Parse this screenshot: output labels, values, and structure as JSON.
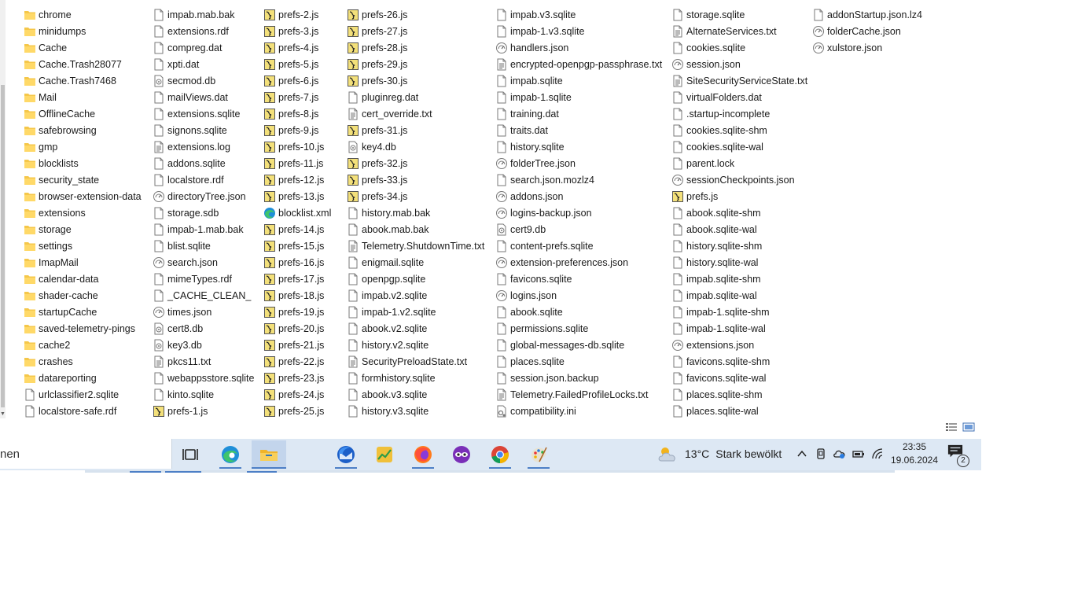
{
  "explorer": {
    "columns": [
      [
        {
          "name": "chrome",
          "icon": "folder-icon"
        },
        {
          "name": "minidumps",
          "icon": "folder-icon"
        },
        {
          "name": "Cache",
          "icon": "folder-icon"
        },
        {
          "name": "Cache.Trash28077",
          "icon": "folder-icon"
        },
        {
          "name": "Cache.Trash7468",
          "icon": "folder-icon"
        },
        {
          "name": "Mail",
          "icon": "folder-icon"
        },
        {
          "name": "OfflineCache",
          "icon": "folder-icon"
        },
        {
          "name": "safebrowsing",
          "icon": "folder-icon"
        },
        {
          "name": "gmp",
          "icon": "folder-icon"
        },
        {
          "name": "blocklists",
          "icon": "folder-icon"
        },
        {
          "name": "security_state",
          "icon": "folder-icon"
        },
        {
          "name": "browser-extension-data",
          "icon": "folder-icon"
        },
        {
          "name": "extensions",
          "icon": "folder-icon"
        },
        {
          "name": "storage",
          "icon": "folder-icon"
        },
        {
          "name": "settings",
          "icon": "folder-icon"
        },
        {
          "name": "ImapMail",
          "icon": "folder-icon"
        },
        {
          "name": "calendar-data",
          "icon": "folder-icon"
        },
        {
          "name": "shader-cache",
          "icon": "folder-icon"
        },
        {
          "name": "startupCache",
          "icon": "folder-icon"
        },
        {
          "name": "saved-telemetry-pings",
          "icon": "folder-icon"
        },
        {
          "name": "cache2",
          "icon": "folder-icon"
        },
        {
          "name": "crashes",
          "icon": "folder-icon"
        },
        {
          "name": "datareporting",
          "icon": "folder-icon"
        },
        {
          "name": "urlclassifier2.sqlite",
          "icon": "file-icon"
        },
        {
          "name": "localstore-safe.rdf",
          "icon": "file-icon"
        }
      ],
      [
        {
          "name": "impab.mab.bak",
          "icon": "file-icon"
        },
        {
          "name": "extensions.rdf",
          "icon": "file-icon"
        },
        {
          "name": "compreg.dat",
          "icon": "file-icon"
        },
        {
          "name": "xpti.dat",
          "icon": "file-icon"
        },
        {
          "name": "secmod.db",
          "icon": "db-file-icon"
        },
        {
          "name": "mailViews.dat",
          "icon": "file-icon"
        },
        {
          "name": "extensions.sqlite",
          "icon": "file-icon"
        },
        {
          "name": "signons.sqlite",
          "icon": "file-icon"
        },
        {
          "name": "extensions.log",
          "icon": "text-file-icon"
        },
        {
          "name": "addons.sqlite",
          "icon": "file-icon"
        },
        {
          "name": "localstore.rdf",
          "icon": "file-icon"
        },
        {
          "name": "directoryTree.json",
          "icon": "json-file-icon"
        },
        {
          "name": "storage.sdb",
          "icon": "file-icon"
        },
        {
          "name": "impab-1.mab.bak",
          "icon": "file-icon"
        },
        {
          "name": "blist.sqlite",
          "icon": "file-icon"
        },
        {
          "name": "search.json",
          "icon": "json-file-icon"
        },
        {
          "name": "mimeTypes.rdf",
          "icon": "file-icon"
        },
        {
          "name": "_CACHE_CLEAN_",
          "icon": "file-icon"
        },
        {
          "name": "times.json",
          "icon": "json-file-icon"
        },
        {
          "name": "cert8.db",
          "icon": "db-file-icon"
        },
        {
          "name": "key3.db",
          "icon": "db-file-icon"
        },
        {
          "name": "pkcs11.txt",
          "icon": "text-file-icon"
        },
        {
          "name": "webappsstore.sqlite",
          "icon": "file-icon"
        },
        {
          "name": "kinto.sqlite",
          "icon": "file-icon"
        },
        {
          "name": "prefs-1.js",
          "icon": "js-file-icon"
        }
      ],
      [
        {
          "name": "prefs-2.js",
          "icon": "js-file-icon"
        },
        {
          "name": "prefs-3.js",
          "icon": "js-file-icon"
        },
        {
          "name": "prefs-4.js",
          "icon": "js-file-icon"
        },
        {
          "name": "prefs-5.js",
          "icon": "js-file-icon"
        },
        {
          "name": "prefs-6.js",
          "icon": "js-file-icon"
        },
        {
          "name": "prefs-7.js",
          "icon": "js-file-icon"
        },
        {
          "name": "prefs-8.js",
          "icon": "js-file-icon"
        },
        {
          "name": "prefs-9.js",
          "icon": "js-file-icon"
        },
        {
          "name": "prefs-10.js",
          "icon": "js-file-icon"
        },
        {
          "name": "prefs-11.js",
          "icon": "js-file-icon"
        },
        {
          "name": "prefs-12.js",
          "icon": "js-file-icon"
        },
        {
          "name": "prefs-13.js",
          "icon": "js-file-icon"
        },
        {
          "name": "blocklist.xml",
          "icon": "edge-file-icon"
        },
        {
          "name": "prefs-14.js",
          "icon": "js-file-icon"
        },
        {
          "name": "prefs-15.js",
          "icon": "js-file-icon"
        },
        {
          "name": "prefs-16.js",
          "icon": "js-file-icon"
        },
        {
          "name": "prefs-17.js",
          "icon": "js-file-icon"
        },
        {
          "name": "prefs-18.js",
          "icon": "js-file-icon"
        },
        {
          "name": "prefs-19.js",
          "icon": "js-file-icon"
        },
        {
          "name": "prefs-20.js",
          "icon": "js-file-icon"
        },
        {
          "name": "prefs-21.js",
          "icon": "js-file-icon"
        },
        {
          "name": "prefs-22.js",
          "icon": "js-file-icon"
        },
        {
          "name": "prefs-23.js",
          "icon": "js-file-icon"
        },
        {
          "name": "prefs-24.js",
          "icon": "js-file-icon"
        },
        {
          "name": "prefs-25.js",
          "icon": "js-file-icon"
        }
      ],
      [
        {
          "name": "prefs-26.js",
          "icon": "js-file-icon"
        },
        {
          "name": "prefs-27.js",
          "icon": "js-file-icon"
        },
        {
          "name": "prefs-28.js",
          "icon": "js-file-icon"
        },
        {
          "name": "prefs-29.js",
          "icon": "js-file-icon"
        },
        {
          "name": "prefs-30.js",
          "icon": "js-file-icon"
        },
        {
          "name": "pluginreg.dat",
          "icon": "file-icon"
        },
        {
          "name": "cert_override.txt",
          "icon": "text-file-icon"
        },
        {
          "name": "prefs-31.js",
          "icon": "js-file-icon"
        },
        {
          "name": "key4.db",
          "icon": "db-file-icon"
        },
        {
          "name": "prefs-32.js",
          "icon": "js-file-icon"
        },
        {
          "name": "prefs-33.js",
          "icon": "js-file-icon"
        },
        {
          "name": "prefs-34.js",
          "icon": "js-file-icon"
        },
        {
          "name": "history.mab.bak",
          "icon": "file-icon"
        },
        {
          "name": "abook.mab.bak",
          "icon": "file-icon"
        },
        {
          "name": "Telemetry.ShutdownTime.txt",
          "icon": "text-file-icon"
        },
        {
          "name": "enigmail.sqlite",
          "icon": "file-icon"
        },
        {
          "name": "openpgp.sqlite",
          "icon": "file-icon"
        },
        {
          "name": "impab.v2.sqlite",
          "icon": "file-icon"
        },
        {
          "name": "impab-1.v2.sqlite",
          "icon": "file-icon"
        },
        {
          "name": "abook.v2.sqlite",
          "icon": "file-icon"
        },
        {
          "name": "history.v2.sqlite",
          "icon": "file-icon"
        },
        {
          "name": "SecurityPreloadState.txt",
          "icon": "text-file-icon"
        },
        {
          "name": "formhistory.sqlite",
          "icon": "file-icon"
        },
        {
          "name": "abook.v3.sqlite",
          "icon": "file-icon"
        },
        {
          "name": "history.v3.sqlite",
          "icon": "file-icon"
        }
      ],
      [
        {
          "name": "impab.v3.sqlite",
          "icon": "file-icon"
        },
        {
          "name": "impab-1.v3.sqlite",
          "icon": "file-icon"
        },
        {
          "name": "handlers.json",
          "icon": "json-file-icon"
        },
        {
          "name": "encrypted-openpgp-passphrase.txt",
          "icon": "text-file-icon"
        },
        {
          "name": "impab.sqlite",
          "icon": "file-icon"
        },
        {
          "name": "impab-1.sqlite",
          "icon": "file-icon"
        },
        {
          "name": "training.dat",
          "icon": "file-icon"
        },
        {
          "name": "traits.dat",
          "icon": "file-icon"
        },
        {
          "name": "history.sqlite",
          "icon": "file-icon"
        },
        {
          "name": "folderTree.json",
          "icon": "json-file-icon"
        },
        {
          "name": "search.json.mozlz4",
          "icon": "file-icon"
        },
        {
          "name": "addons.json",
          "icon": "json-file-icon"
        },
        {
          "name": "logins-backup.json",
          "icon": "json-file-icon"
        },
        {
          "name": "cert9.db",
          "icon": "db-file-icon"
        },
        {
          "name": "content-prefs.sqlite",
          "icon": "file-icon"
        },
        {
          "name": "extension-preferences.json",
          "icon": "json-file-icon"
        },
        {
          "name": "favicons.sqlite",
          "icon": "file-icon"
        },
        {
          "name": "logins.json",
          "icon": "json-file-icon"
        },
        {
          "name": "abook.sqlite",
          "icon": "file-icon"
        },
        {
          "name": "permissions.sqlite",
          "icon": "file-icon"
        },
        {
          "name": "global-messages-db.sqlite",
          "icon": "file-icon"
        },
        {
          "name": "places.sqlite",
          "icon": "file-icon"
        },
        {
          "name": "session.json.backup",
          "icon": "file-icon"
        },
        {
          "name": "Telemetry.FailedProfileLocks.txt",
          "icon": "text-file-icon"
        },
        {
          "name": "compatibility.ini",
          "icon": "ini-file-icon"
        }
      ],
      [
        {
          "name": "storage.sqlite",
          "icon": "file-icon"
        },
        {
          "name": "AlternateServices.txt",
          "icon": "text-file-icon"
        },
        {
          "name": "cookies.sqlite",
          "icon": "file-icon"
        },
        {
          "name": "session.json",
          "icon": "json-file-icon"
        },
        {
          "name": "SiteSecurityServiceState.txt",
          "icon": "text-file-icon"
        },
        {
          "name": "virtualFolders.dat",
          "icon": "file-icon"
        },
        {
          "name": ".startup-incomplete",
          "icon": "file-icon"
        },
        {
          "name": "cookies.sqlite-shm",
          "icon": "file-icon"
        },
        {
          "name": "cookies.sqlite-wal",
          "icon": "file-icon"
        },
        {
          "name": "parent.lock",
          "icon": "file-icon"
        },
        {
          "name": "sessionCheckpoints.json",
          "icon": "json-file-icon"
        },
        {
          "name": "prefs.js",
          "icon": "js-file-icon"
        },
        {
          "name": "abook.sqlite-shm",
          "icon": "file-icon"
        },
        {
          "name": "abook.sqlite-wal",
          "icon": "file-icon"
        },
        {
          "name": "history.sqlite-shm",
          "icon": "file-icon"
        },
        {
          "name": "history.sqlite-wal",
          "icon": "file-icon"
        },
        {
          "name": "impab.sqlite-shm",
          "icon": "file-icon"
        },
        {
          "name": "impab.sqlite-wal",
          "icon": "file-icon"
        },
        {
          "name": "impab-1.sqlite-shm",
          "icon": "file-icon"
        },
        {
          "name": "impab-1.sqlite-wal",
          "icon": "file-icon"
        },
        {
          "name": "extensions.json",
          "icon": "json-file-icon"
        },
        {
          "name": "favicons.sqlite-shm",
          "icon": "file-icon"
        },
        {
          "name": "favicons.sqlite-wal",
          "icon": "file-icon"
        },
        {
          "name": "places.sqlite-shm",
          "icon": "file-icon"
        },
        {
          "name": "places.sqlite-wal",
          "icon": "file-icon"
        }
      ],
      [
        {
          "name": "addonStartup.json.lz4",
          "icon": "file-icon"
        },
        {
          "name": "folderCache.json",
          "icon": "json-file-icon"
        },
        {
          "name": "xulstore.json",
          "icon": "json-file-icon"
        }
      ]
    ]
  },
  "taskbar": {
    "search_text": "nen",
    "apps": [
      {
        "id": "task-view",
        "icon": "task-view-icon"
      },
      {
        "id": "edge",
        "icon": "edge-icon"
      },
      {
        "id": "file-explorer",
        "icon": "file-explorer-icon"
      },
      {
        "id": "thunderbird",
        "icon": "thunderbird-icon"
      },
      {
        "id": "chart-app",
        "icon": "chart-app-icon"
      },
      {
        "id": "firefox",
        "icon": "firefox-icon"
      },
      {
        "id": "mask-app",
        "icon": "mask-app-icon"
      },
      {
        "id": "chrome",
        "icon": "chrome-icon"
      },
      {
        "id": "paint",
        "icon": "paint-icon"
      }
    ],
    "weather": {
      "temp": "13°C",
      "desc": "Stark bewölkt"
    },
    "clock": {
      "time": "23:35",
      "date": "19.06.2024"
    },
    "notifications": {
      "count": "2"
    }
  },
  "colors": {
    "folder": "#f5c74a",
    "accent": "#4d7fc6",
    "taskbar": "#dde8f4"
  }
}
